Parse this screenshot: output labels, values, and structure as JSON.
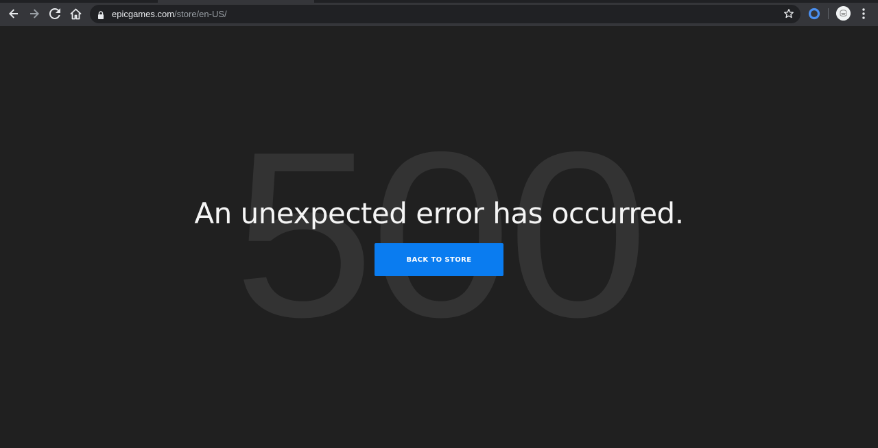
{
  "browser": {
    "url_host": "epicgames.com",
    "url_path": "/store/en-US/",
    "icons": {
      "back": "arrow-left-icon",
      "forward": "arrow-right-icon",
      "reload": "reload-icon",
      "home": "home-icon",
      "secure": "lock-icon",
      "bookmark": "star-icon",
      "extension": "extension-ring-icon",
      "profile": "avatar",
      "menu": "kebab-menu-icon"
    }
  },
  "page": {
    "background_code": "500",
    "headline": "An unexpected error has occurred.",
    "back_button_label": "BACK TO STORE"
  },
  "colors": {
    "page_background": "#202020",
    "background_code": "#333333",
    "headline": "#f5f5f5",
    "button": "#0a7cf0",
    "button_text": "#ffffff",
    "toolbar": "#35363a",
    "omnibox": "#202124"
  }
}
